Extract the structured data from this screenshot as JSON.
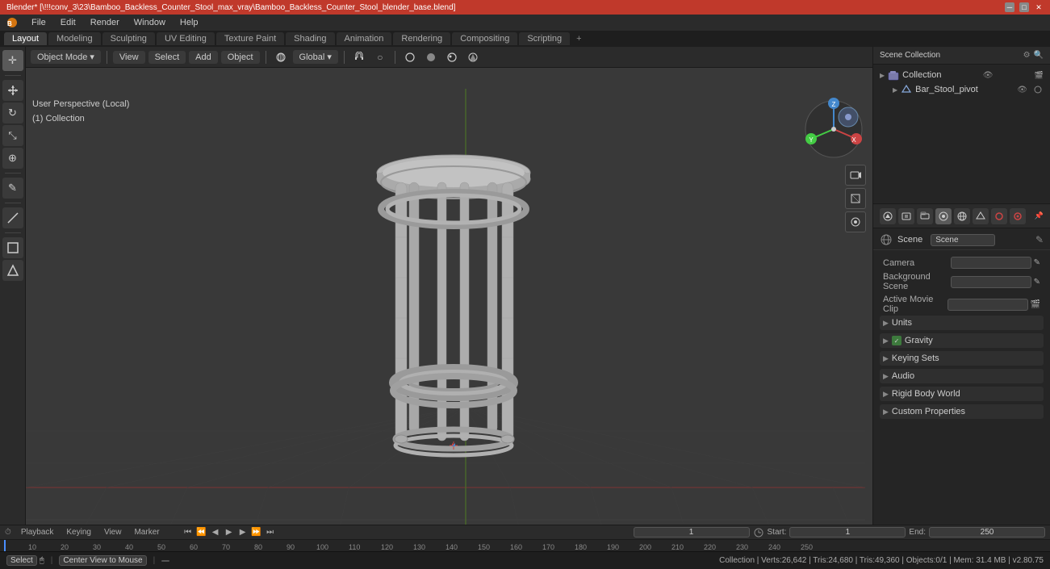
{
  "titlebar": {
    "title": "Blender* [\\!!!conv_3\\23\\Bamboo_Backless_Counter_Stool_max_vray\\Bamboo_Backless_Counter_Stool_blender_base.blend]",
    "controls": [
      "minimize",
      "maximize",
      "close"
    ]
  },
  "menubar": {
    "items": [
      "Blender",
      "File",
      "Edit",
      "Render",
      "Window",
      "Help"
    ]
  },
  "workspace_tabs": {
    "tabs": [
      "Layout",
      "Modeling",
      "Sculpting",
      "UV Editing",
      "Texture Paint",
      "Shading",
      "Animation",
      "Rendering",
      "Compositing",
      "Scripting"
    ],
    "active": "Layout"
  },
  "viewport": {
    "mode": "Object Mode",
    "view_label": "View",
    "select_label": "Select",
    "add_label": "Add",
    "object_label": "Object",
    "transform": "Global",
    "info_line1": "User Perspective (Local)",
    "info_line2": "(1) Collection"
  },
  "left_toolbar": {
    "tools": [
      {
        "name": "cursor-tool",
        "icon": "✛"
      },
      {
        "name": "move-tool",
        "icon": "↔"
      },
      {
        "name": "rotate-tool",
        "icon": "↻"
      },
      {
        "name": "scale-tool",
        "icon": "⤡"
      },
      {
        "name": "transform-tool",
        "icon": "⊕"
      },
      {
        "name": "annotate-tool",
        "icon": "✎"
      },
      {
        "name": "measure-tool",
        "icon": "📏"
      },
      {
        "name": "add-cube-tool",
        "icon": "⬛"
      }
    ]
  },
  "outliner": {
    "title": "Scene Collection",
    "items": [
      {
        "name": "Collection",
        "level": 0,
        "icon": "📁",
        "visible": true
      },
      {
        "name": "Bar_Stool_pivot",
        "level": 1,
        "icon": "⬡",
        "visible": true
      }
    ]
  },
  "properties": {
    "scene_name": "Scene",
    "scene_label": "Scene",
    "sections": [
      {
        "name": "Camera",
        "expanded": false,
        "value": ""
      },
      {
        "name": "Background Scene",
        "expanded": false,
        "value": ""
      },
      {
        "name": "Active Movie Clip",
        "expanded": false,
        "value": ""
      },
      {
        "name": "Units",
        "expanded": false
      },
      {
        "name": "Gravity",
        "expanded": false,
        "checked": true
      },
      {
        "name": "Keying Sets",
        "expanded": false
      },
      {
        "name": "Audio",
        "expanded": false
      },
      {
        "name": "Rigid Body World",
        "expanded": false
      },
      {
        "name": "Custom Properties",
        "expanded": false
      }
    ]
  },
  "timeline": {
    "playback_label": "Playback",
    "keying_label": "Keying",
    "view_label": "View",
    "marker_label": "Marker",
    "current_frame": "1",
    "start_label": "Start:",
    "start_frame": "1",
    "end_label": "End:",
    "end_frame": "250",
    "frame_markers": [
      "10",
      "20",
      "30",
      "40",
      "50",
      "60",
      "70",
      "80",
      "90",
      "100",
      "110",
      "120",
      "130",
      "140",
      "150",
      "160",
      "170",
      "180",
      "190",
      "200",
      "210",
      "220",
      "230",
      "240",
      "250"
    ]
  },
  "statusbar": {
    "select_key": "Select",
    "center_key": "Center View to Mouse",
    "stats": "Collection | Verts:26,642 | Tris:24,680 | Tris:49,360 | Objects:0/1 | Mem: 31.4 MB | v2.80.75"
  },
  "gizmo": {
    "x_label": "X",
    "y_label": "Y",
    "z_label": "Z"
  },
  "colors": {
    "accent_blue": "#4a8fff",
    "titlebar_red": "#c0392b",
    "grid_dark": "#3d3d3d",
    "grid_line": "#454545",
    "x_axis": "#cc3333",
    "y_axis": "#aacc00",
    "bg": "#393939"
  }
}
